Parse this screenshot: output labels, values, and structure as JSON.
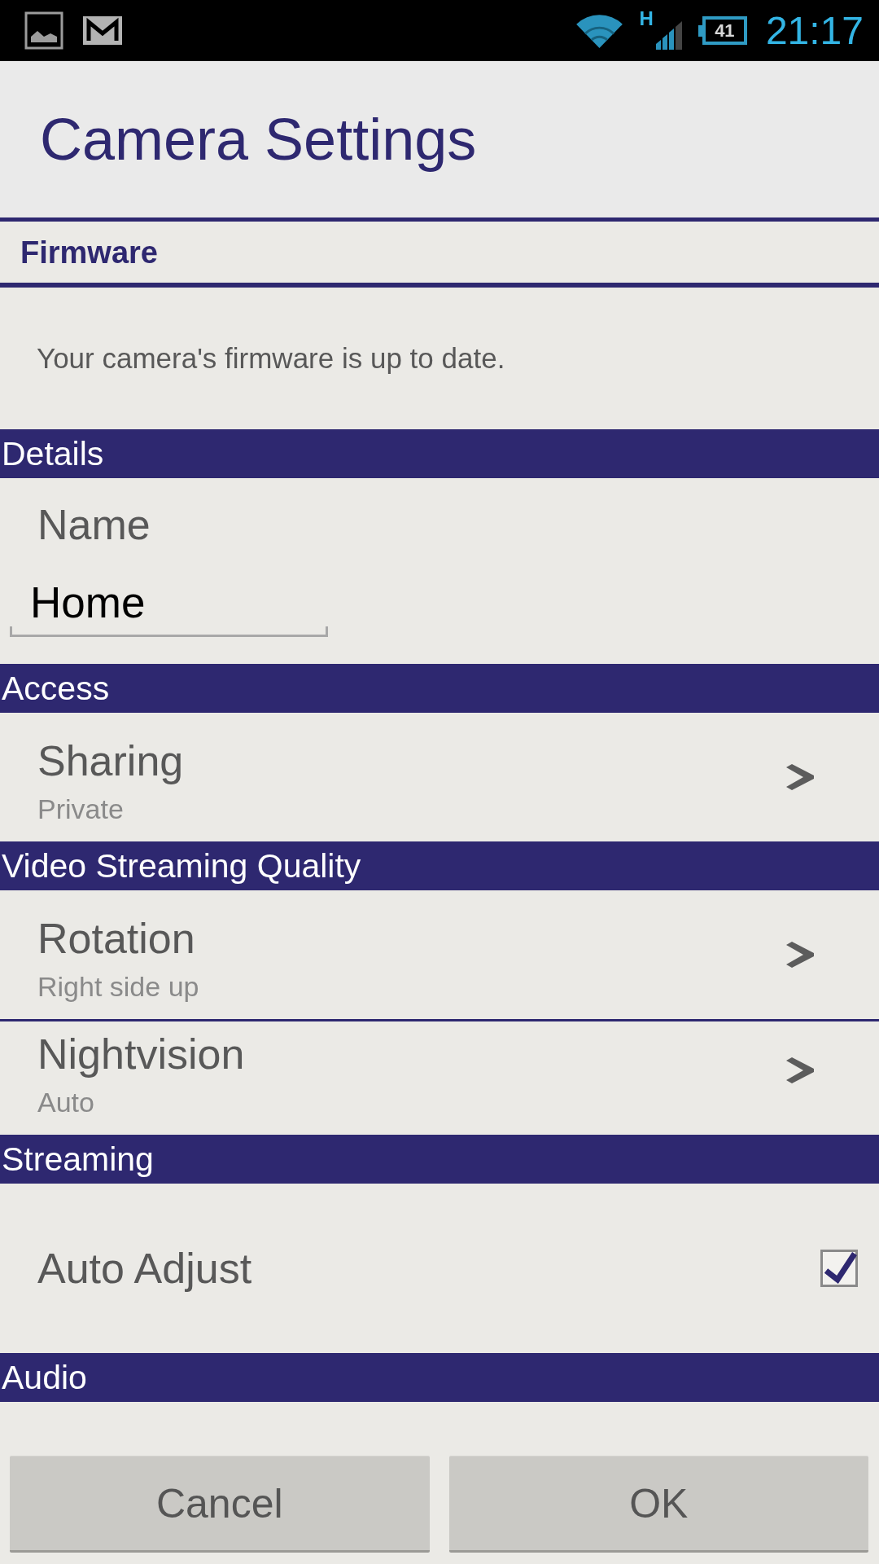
{
  "status_bar": {
    "network_type": "H",
    "battery": "41",
    "time": "21:17"
  },
  "header": {
    "title": "Camera Settings"
  },
  "sections": [
    {
      "kind": "subheader",
      "title": "Firmware",
      "items": [
        {
          "kind": "message",
          "text": "Your camera's firmware is up to date."
        }
      ]
    },
    {
      "kind": "bar",
      "title": "Details",
      "items": [
        {
          "kind": "text_field",
          "label": "Name",
          "value": "Home"
        }
      ]
    },
    {
      "kind": "bar",
      "title": "Access",
      "items": [
        {
          "kind": "link",
          "title": "Sharing",
          "summary": "Private"
        }
      ]
    },
    {
      "kind": "bar",
      "title": "Video Streaming Quality",
      "items": [
        {
          "kind": "link",
          "title": "Rotation",
          "summary": "Right side up"
        },
        {
          "kind": "link",
          "title": "Nightvision",
          "summary": "Auto"
        }
      ]
    },
    {
      "kind": "bar",
      "title": "Streaming",
      "items": [
        {
          "kind": "checkbox",
          "title": "Auto Adjust",
          "checked": true
        }
      ]
    },
    {
      "kind": "bar",
      "title": "Audio"
    }
  ],
  "buttons": [
    {
      "label": "Cancel"
    },
    {
      "label": "OK"
    }
  ]
}
